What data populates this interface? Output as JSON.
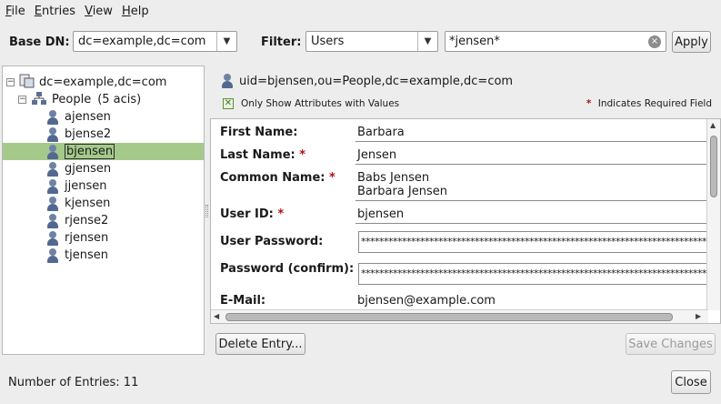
{
  "menu": {
    "items": [
      {
        "mnemonic": "F",
        "rest": "ile"
      },
      {
        "mnemonic": "E",
        "rest": "ntries"
      },
      {
        "mnemonic": "V",
        "rest": "iew"
      },
      {
        "mnemonic": "H",
        "rest": "elp"
      }
    ]
  },
  "toolbar": {
    "base_dn_label": "Base DN:",
    "base_dn_value": "dc=example,dc=com",
    "filter_label": "Filter:",
    "filter_type": "Users",
    "filter_text": "*jensen*",
    "apply_label": "Apply"
  },
  "tree": {
    "root": "dc=example,dc=com",
    "branch": "People",
    "branch_count": "(5 acis)",
    "entries": [
      "ajensen",
      "bjense2",
      "bjensen",
      "gjensen",
      "jjensen",
      "kjensen",
      "rjense2",
      "rjensen",
      "tjensen"
    ],
    "selected_index": 2
  },
  "detail": {
    "dn": "uid=bjensen,ou=People,dc=example,dc=com",
    "only_show_label": "Only Show Attributes with Values",
    "required_marker": "*",
    "required_note": "Indicates Required Field",
    "attributes": {
      "first_name_label": "First Name:",
      "first_name": "Barbara",
      "last_name_label": "Last Name:",
      "last_name": "Jensen",
      "common_name_label": "Common Name:",
      "common_name_1": "Babs Jensen",
      "common_name_2": "Barbara Jensen",
      "user_id_label": "User ID:",
      "user_id": "bjensen",
      "password_label": "User Password:",
      "password_value": "************************************************************************************",
      "password_confirm_label": "Password (confirm):",
      "password_confirm_value": "************************************************************************************",
      "email_label": "E-Mail:",
      "email": "bjensen@example.com"
    },
    "delete_label": "Delete Entry...",
    "save_label": "Save Changes"
  },
  "footer": {
    "entries_count": "Number of Entries: 11",
    "close_label": "Close"
  }
}
